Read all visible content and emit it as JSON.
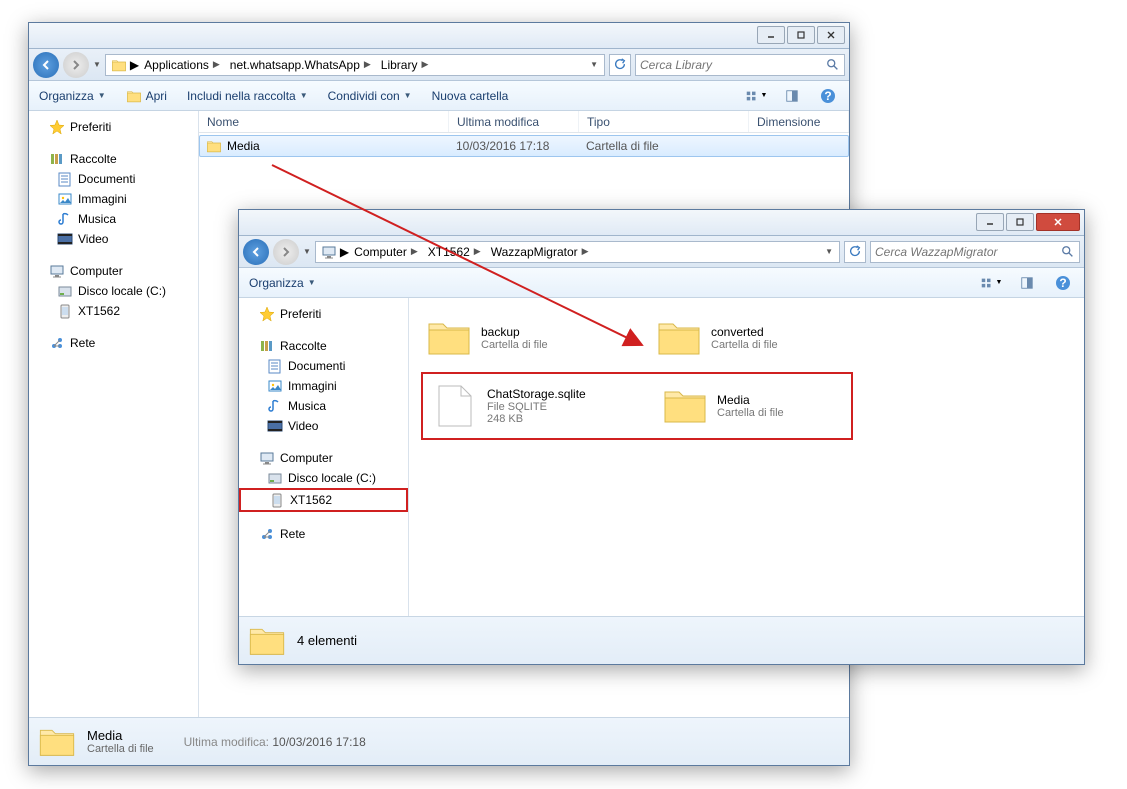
{
  "win1": {
    "crumbs": [
      "Applications",
      "net.whatsapp.WhatsApp",
      "Library"
    ],
    "search_ph": "Cerca Library",
    "toolbar": {
      "organizza": "Organizza",
      "apri": "Apri",
      "includi": "Includi nella raccolta",
      "condividi": "Condividi con",
      "nuova": "Nuova cartella"
    },
    "cols": {
      "name": "Nome",
      "mod": "Ultima modifica",
      "type": "Tipo",
      "size": "Dimensione"
    },
    "sidebar": {
      "preferiti": "Preferiti",
      "raccolte": "Raccolte",
      "documenti": "Documenti",
      "immagini": "Immagini",
      "musica": "Musica",
      "video": "Video",
      "computer": "Computer",
      "disco": "Disco locale (C:)",
      "xt": "XT1562",
      "rete": "Rete"
    },
    "item": {
      "name": "Media",
      "mod": "10/03/2016 17:18",
      "type": "Cartella di file"
    },
    "status": {
      "name": "Media",
      "type": "Cartella di file",
      "mod_label": "Ultima modifica:",
      "mod_val": "10/03/2016 17:18"
    }
  },
  "win2": {
    "crumbs": [
      "Computer",
      "XT1562",
      "WazzapMigrator"
    ],
    "search_ph": "Cerca WazzapMigrator",
    "toolbar": {
      "organizza": "Organizza"
    },
    "sidebar": {
      "preferiti": "Preferiti",
      "raccolte": "Raccolte",
      "documenti": "Documenti",
      "immagini": "Immagini",
      "musica": "Musica",
      "video": "Video",
      "computer": "Computer",
      "disco": "Disco locale (C:)",
      "xt": "XT1562",
      "rete": "Rete"
    },
    "tiles": {
      "backup": {
        "name": "backup",
        "sub": "Cartella di file"
      },
      "converted": {
        "name": "converted",
        "sub": "Cartella di file"
      },
      "chatstorage": {
        "name": "ChatStorage.sqlite",
        "sub1": "File SQLITE",
        "sub2": "248 KB"
      },
      "media": {
        "name": "Media",
        "sub": "Cartella di file"
      }
    },
    "status": {
      "count": "4 elementi"
    }
  }
}
